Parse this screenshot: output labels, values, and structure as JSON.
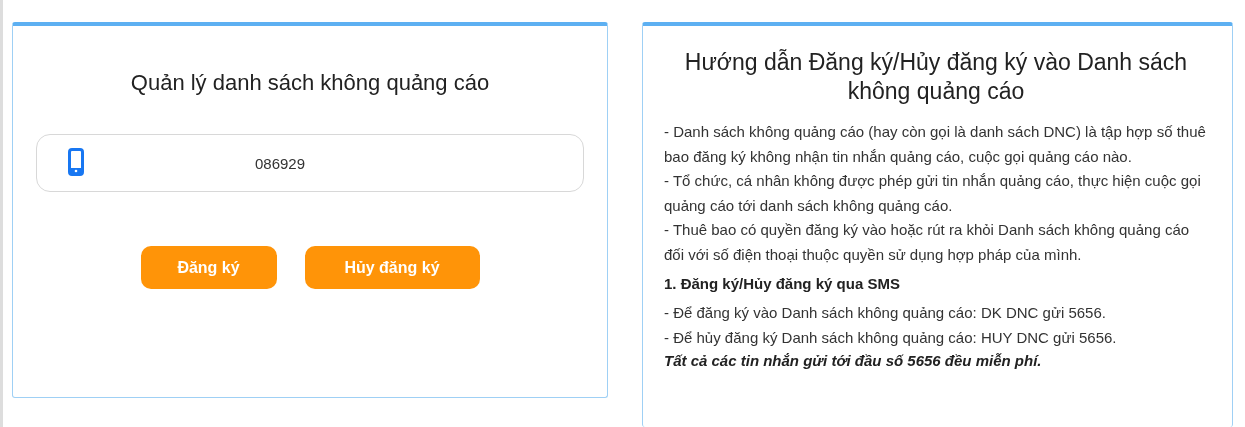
{
  "register_panel": {
    "title": "Quản lý danh sách không quảng cáo",
    "phone_field": {
      "value": "086929"
    },
    "buttons": [
      {
        "label": "Đăng ký"
      },
      {
        "label": "Hủy đăng ký"
      }
    ]
  },
  "guide_panel": {
    "title": "Hướng dẫn Đăng ký/Hủy đăng ký vào Danh sách không quảng cáo",
    "blocks": [
      {
        "kind": "paragraph",
        "text": "- Danh sách không quảng cáo (hay còn gọi là danh sách DNC) là tập hợp số thuê bao đăng ký không nhận tin nhắn quảng cáo, cuộc gọi quảng cáo nào."
      },
      {
        "kind": "paragraph",
        "text": "- Tổ chức, cá nhân không được phép gửi tin nhắn quảng cáo, thực hiện cuộc gọi quảng cáo tới danh sách không quảng cáo."
      },
      {
        "kind": "paragraph",
        "text": "- Thuê bao có quyền đăng ký vào hoặc rút ra khỏi Danh sách không quảng cáo đối với số điện thoại thuộc quyền sử dụng hợp pháp của mình."
      },
      {
        "kind": "heading",
        "text": "1. Đăng ký/Hủy đăng ký qua SMS"
      },
      {
        "kind": "paragraph",
        "text": "- Để đăng ký vào Danh sách không quảng cáo: DK DNC gửi 5656."
      },
      {
        "kind": "paragraph",
        "text": "- Để hủy đăng ký Danh sách không quảng cáo: HUY DNC gửi 5656."
      },
      {
        "kind": "note",
        "text": "Tất cả các tin nhắn gửi tới đầu số 5656 đều miễn phí."
      }
    ]
  }
}
